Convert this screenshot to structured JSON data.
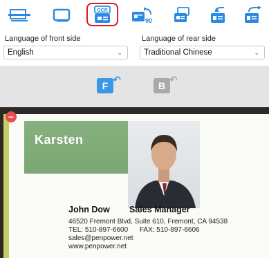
{
  "toolbar": {
    "buttons": [
      {
        "icon": "scan-icon",
        "label": ""
      },
      {
        "icon": "window-icon",
        "label": ""
      },
      {
        "icon": "ocr-icon",
        "label": "OCR",
        "active": true
      },
      {
        "icon": "rotate-90-icon",
        "label": "90"
      },
      {
        "icon": "card-flip-icon",
        "label": ""
      },
      {
        "icon": "card-rotate-left-icon",
        "label": ""
      },
      {
        "icon": "card-rotate-right-icon",
        "label": ""
      }
    ]
  },
  "language": {
    "front_label": "Language of front side",
    "front_value": "English",
    "rear_label": "Language of rear side",
    "rear_value": "Traditional Chinese"
  },
  "sides": {
    "front": "F",
    "back": "B"
  },
  "card": {
    "banner_name": "Karsten",
    "name": "John Dow",
    "title": "Sales Manager",
    "address": "46520 Fremont Blvd, Suite 610, Fremont, CA 94538",
    "phone_line": "TEL: 510-897-6600      FAX: 510-897-6606",
    "email": "sales@penpower.net",
    "website": "www.penpower.net",
    "remove_symbol": "−"
  },
  "colors": {
    "accent_blue": "#2b8ae3",
    "active_border": "#e0171e",
    "side_front": "#3b97e8",
    "side_back": "#a9a9a9"
  }
}
